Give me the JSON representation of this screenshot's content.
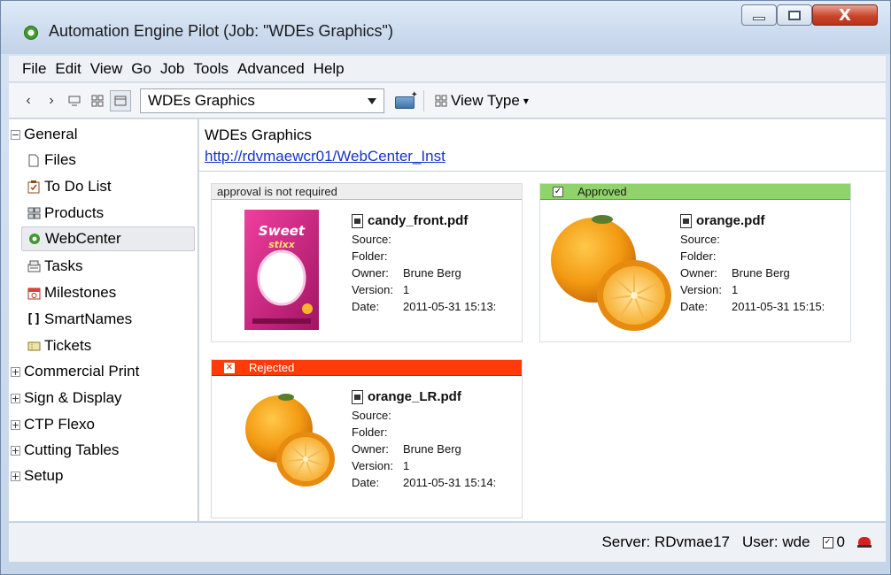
{
  "window": {
    "title": "Automation Engine Pilot (Job: \"WDEs Graphics\")",
    "close_glyph": "X"
  },
  "menu": [
    "File",
    "Edit",
    "View",
    "Go",
    "Job",
    "Tools",
    "Advanced",
    "Help"
  ],
  "toolbar": {
    "job_selected": "WDEs Graphics",
    "view_type_label": "View Type",
    "view_type_caret": "▾"
  },
  "sidebar": {
    "groups": [
      {
        "label": "General",
        "expander": "−",
        "expanded": true,
        "items": [
          {
            "label": "Files",
            "icon": "file-icon"
          },
          {
            "label": "To Do List",
            "icon": "todo-icon"
          },
          {
            "label": "Products",
            "icon": "products-icon"
          },
          {
            "label": "WebCenter",
            "icon": "webcenter-icon",
            "selected": true
          },
          {
            "label": "Tasks",
            "icon": "tasks-icon"
          },
          {
            "label": "Milestones",
            "icon": "milestones-icon"
          },
          {
            "label": "SmartNames",
            "icon": "smartnames-icon"
          },
          {
            "label": "Tickets",
            "icon": "tickets-icon"
          }
        ]
      },
      {
        "label": "Commercial Print",
        "expander": "+"
      },
      {
        "label": "Sign & Display",
        "expander": "+"
      },
      {
        "label": "CTP Flexo",
        "expander": "+"
      },
      {
        "label": "Cutting Tables",
        "expander": "+"
      },
      {
        "label": "Setup",
        "expander": "+"
      }
    ]
  },
  "main": {
    "heading": "WDEs Graphics",
    "link": "http://rdvmaewcr01/WebCenter_Inst"
  },
  "cards": [
    {
      "status": "approval is not required",
      "status_kind": "none",
      "file": "candy_front.pdf",
      "source": "",
      "folder": "",
      "owner": "Brune Berg",
      "version": "1",
      "date": "2011-05-31 15:13:",
      "thumb": "candy-package",
      "thumb_text": "Sweet stixx"
    },
    {
      "status": "Approved",
      "status_kind": "approved",
      "file": "orange.pdf",
      "source": "",
      "folder": "",
      "owner": "Brune Berg",
      "version": "1",
      "date": "2011-05-31 15:15:",
      "thumb": "orange-large"
    },
    {
      "status": "Rejected",
      "status_kind": "rejected",
      "file": "orange_LR.pdf",
      "source": "",
      "folder": "",
      "owner": "Brune Berg",
      "version": "1",
      "date": "2011-05-31 15:14:",
      "thumb": "orange-small"
    }
  ],
  "meta_labels": {
    "source": "Source:",
    "folder": "Folder:",
    "owner": "Owner:",
    "version": "Version:",
    "date": "Date:"
  },
  "statusbar": {
    "server": "Server: RDvmae17",
    "user": "User: wde",
    "todo_count": "0"
  },
  "colors": {
    "approved": "#8fd36a",
    "rejected": "#ff3b0a",
    "link": "#1733c9",
    "selected_row": "#e9ebee"
  }
}
